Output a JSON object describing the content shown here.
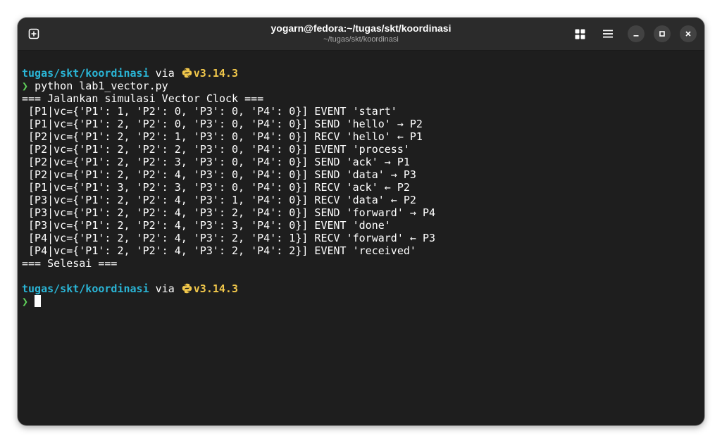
{
  "window": {
    "title": "yogarn@fedora:~/tugas/skt/koordinasi",
    "subtitle": "~/tugas/skt/koordinasi",
    "icons": {
      "new_tab": "new-tab-icon",
      "grid": "grid-view-icon",
      "menu": "hamburger-menu-icon",
      "minimize": "minimize-icon",
      "maximize": "maximize-icon",
      "close": "close-icon"
    }
  },
  "terminal": {
    "prompt1": {
      "dir": "tugas/skt/koordinasi",
      "via": "via",
      "python_icon": "python-icon",
      "version": "v3.14.3"
    },
    "command": {
      "chevron": "❯",
      "text": "python lab1_vector.py"
    },
    "output": [
      "=== Jalankan simulasi Vector Clock ===",
      " [P1|vc={'P1': 1, 'P2': 0, 'P3': 0, 'P4': 0}] EVENT 'start'",
      " [P1|vc={'P1': 2, 'P2': 0, 'P3': 0, 'P4': 0}] SEND 'hello' → P2",
      " [P2|vc={'P1': 2, 'P2': 1, 'P3': 0, 'P4': 0}] RECV 'hello' ← P1",
      " [P2|vc={'P1': 2, 'P2': 2, 'P3': 0, 'P4': 0}] EVENT 'process'",
      " [P2|vc={'P1': 2, 'P2': 3, 'P3': 0, 'P4': 0}] SEND 'ack' → P1",
      " [P2|vc={'P1': 2, 'P2': 4, 'P3': 0, 'P4': 0}] SEND 'data' → P3",
      " [P1|vc={'P1': 3, 'P2': 3, 'P3': 0, 'P4': 0}] RECV 'ack' ← P2",
      " [P3|vc={'P1': 2, 'P2': 4, 'P3': 1, 'P4': 0}] RECV 'data' ← P2",
      " [P3|vc={'P1': 2, 'P2': 4, 'P3': 2, 'P4': 0}] SEND 'forward' → P4",
      " [P3|vc={'P1': 2, 'P2': 4, 'P3': 3, 'P4': 0}] EVENT 'done'",
      " [P4|vc={'P1': 2, 'P2': 4, 'P3': 2, 'P4': 1}] RECV 'forward' ← P3",
      " [P4|vc={'P1': 2, 'P2': 4, 'P3': 2, 'P4': 2}] EVENT 'received'",
      "=== Selesai ==="
    ],
    "prompt2": {
      "dir": "tugas/skt/koordinasi",
      "via": "via",
      "version": "v3.14.3",
      "chevron": "❯"
    },
    "colors": {
      "dir": "#2ab5d6",
      "python": "#f2c84b",
      "chevron": "#5fd15a",
      "background": "#1e1e1e"
    }
  }
}
